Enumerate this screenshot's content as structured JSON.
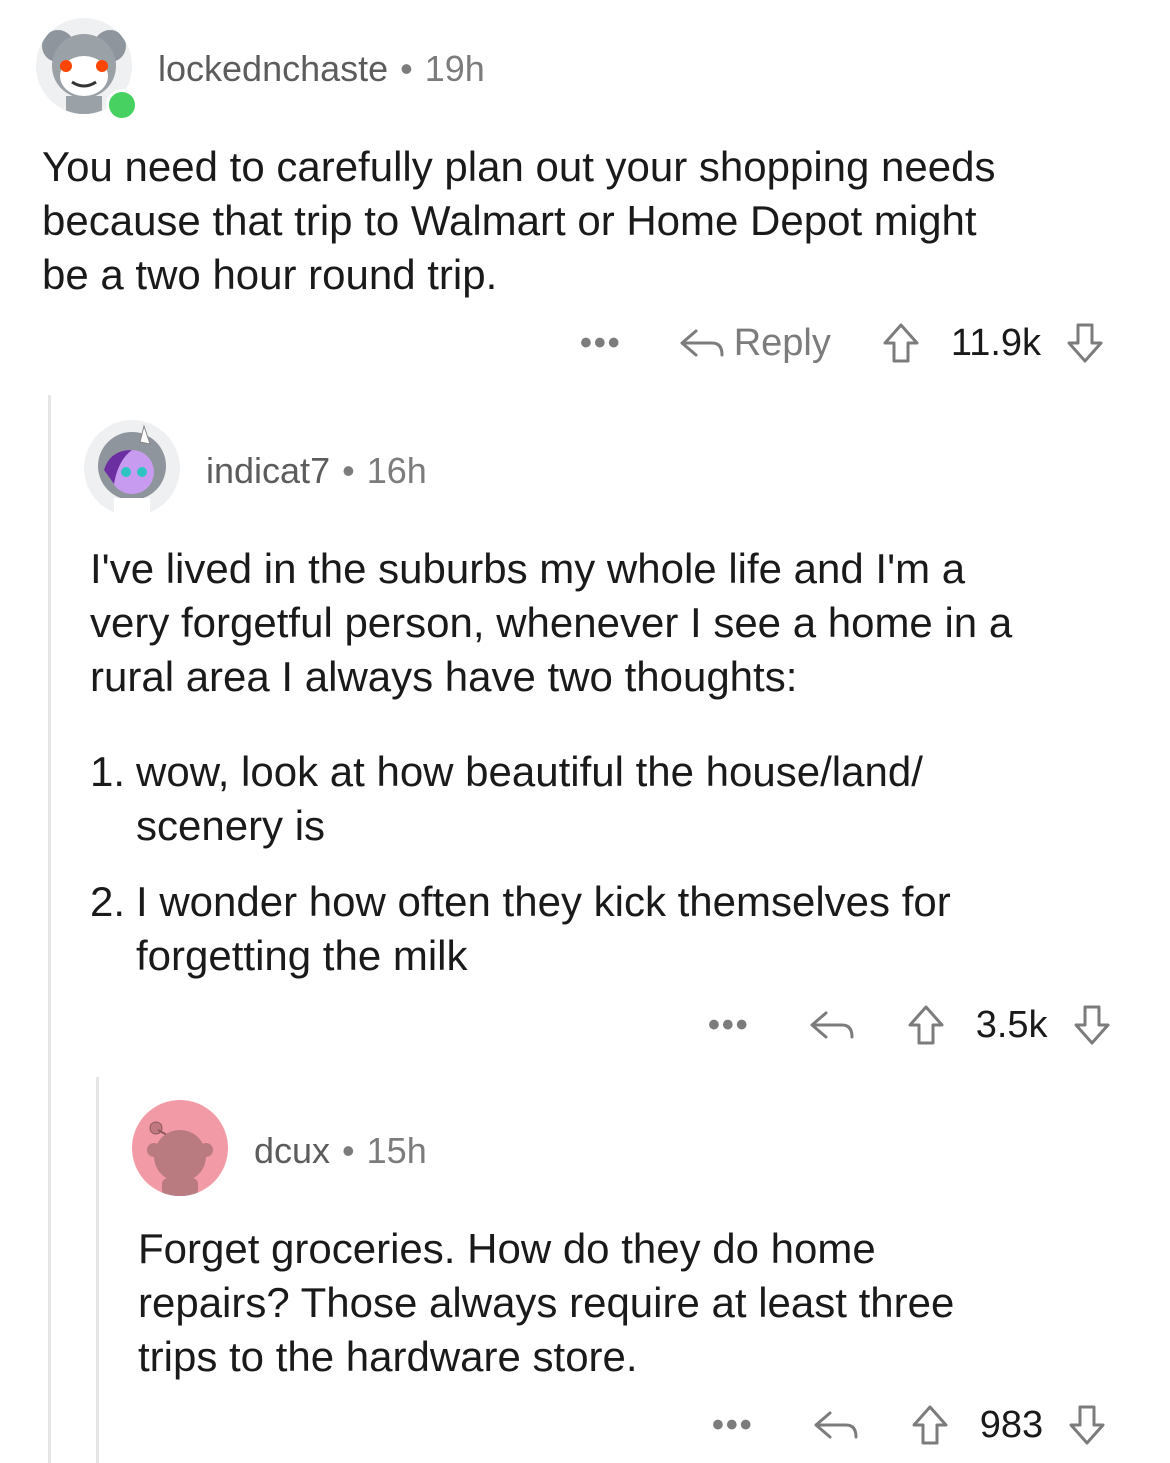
{
  "comments": [
    {
      "username": "lockednchaste",
      "age": "19h",
      "body": [
        "You need to carefully plan out your shopping needs",
        "because that trip to Walmart or Home Depot might",
        "be a two hour round trip."
      ],
      "reply_label": "Reply",
      "score": "11.9k",
      "more": "•••"
    },
    {
      "username": "indicat7",
      "age": "16h",
      "body": [
        "I've lived in the suburbs my whole life and I'm a",
        "very forgetful person, whenever I see a home in a",
        "rural area I always have two thoughts:"
      ],
      "list": [
        {
          "num": "1.",
          "lines": [
            "wow, look at how beautiful the house/land/",
            "scenery is"
          ]
        },
        {
          "num": "2.",
          "lines": [
            "I wonder how often they kick themselves for",
            "forgetting the milk"
          ]
        }
      ],
      "score": "3.5k",
      "more": "•••"
    },
    {
      "username": "dcux",
      "age": "15h",
      "body": [
        "Forget groceries. How do they do home",
        "repairs? Those always require at least three",
        "trips to the hardware store."
      ],
      "score": "983",
      "more": "•••"
    }
  ],
  "separator": "•",
  "icons": {
    "reply": "reply-arrow-icon",
    "upvote": "upvote-arrow-icon",
    "downvote": "downvote-arrow-icon",
    "online": "online-status-dot"
  },
  "colors": {
    "meta": "#7c7c7c",
    "online": "#46d160",
    "avatar3_bg": "#f39aa7"
  }
}
